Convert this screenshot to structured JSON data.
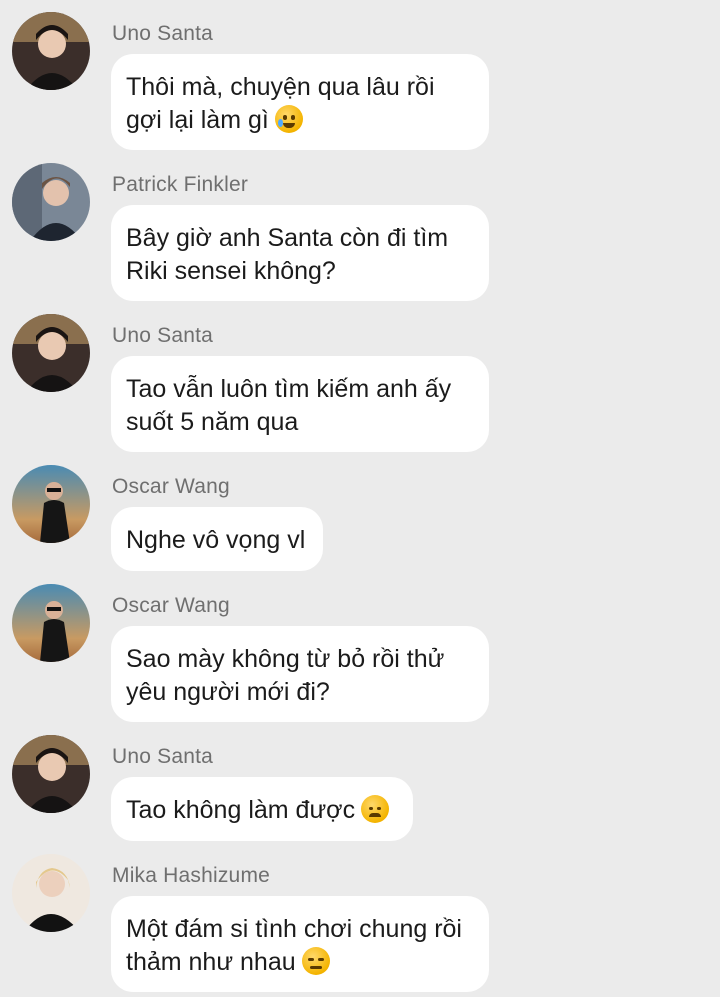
{
  "messages": [
    {
      "sender": "Uno Santa",
      "lines": [
        "Thôi mà, chuyện qua lâu rồi",
        "gợi lại làm gì"
      ],
      "emoji": "smiling-face-with-tear-icon"
    },
    {
      "sender": "Patrick Finkler",
      "lines": [
        "Bây giờ anh Santa còn đi tìm",
        "Riki sensei không?"
      ],
      "emoji": ""
    },
    {
      "sender": "Uno Santa",
      "lines": [
        "Tao vẫn luôn tìm kiếm anh ấy",
        "suốt 5 năm qua"
      ],
      "emoji": ""
    },
    {
      "sender": "Oscar Wang",
      "lines": [
        "Nghe vô vọng vl"
      ],
      "emoji": ""
    },
    {
      "sender": "Oscar Wang",
      "lines": [
        "Sao mày không từ bỏ rồi thử",
        "yêu người mới đi?"
      ],
      "emoji": ""
    },
    {
      "sender": "Uno Santa",
      "lines": [
        "Tao không làm được"
      ],
      "emoji": "disappointed-face-icon"
    },
    {
      "sender": "Mika Hashizume",
      "lines": [
        "Một đám si tình chơi chung rồi",
        "thảm như nhau"
      ],
      "emoji": "expressionless-face-icon"
    }
  ],
  "colors": {
    "background": "#ebebeb",
    "bubble": "#ffffff",
    "sender_name": "#6f6f6f",
    "text": "#1b1b1b"
  }
}
